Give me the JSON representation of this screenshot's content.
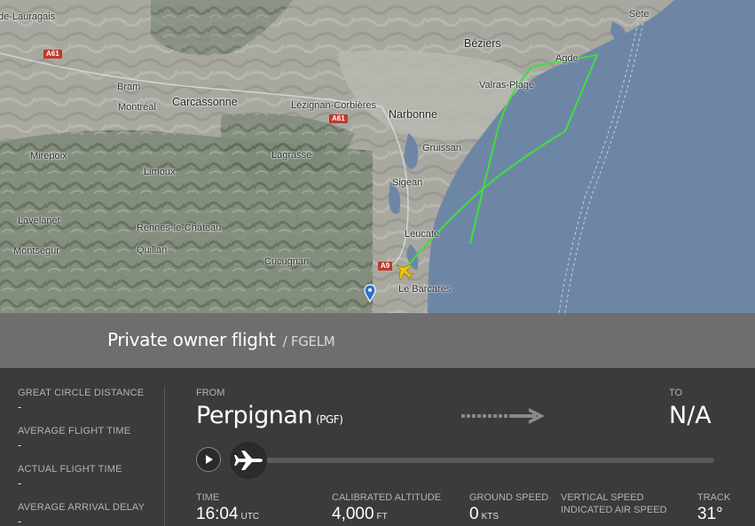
{
  "map": {
    "labels": {
      "lauragais": "de-Lauragais",
      "sete": "Sète",
      "beziers": "Béziers",
      "agde": "Agde",
      "bram": "Bram",
      "carcassonne": "Carcassonne",
      "lezignan": "Lézignan-Corbières",
      "narbonne": "Narbonne",
      "valras": "Valras-Plage",
      "montreal": "Montréal",
      "gruissan": "Gruissan",
      "mirepoix": "Mirepoix",
      "lagrasse": "Lagrasse",
      "limoux": "Limoux",
      "sigean": "Sigean",
      "lavelanet": "Lavelanet",
      "rennes": "Rennes-le-Château",
      "leucate": "Leucate",
      "montsegur": "Montségur",
      "quillan": "Quillan",
      "cucugnan": "Cucugnan",
      "barcares": "Le Barcarès"
    },
    "roads": {
      "a61_west": "A61",
      "a61_east": "A61",
      "a9": "A9"
    },
    "track_color": "#3de03d"
  },
  "flight": {
    "title": "Private owner flight",
    "callsign": "/ FGELM"
  },
  "stats": [
    {
      "label": "GREAT CIRCLE DISTANCE",
      "value": "-"
    },
    {
      "label": "AVERAGE FLIGHT TIME",
      "value": "-"
    },
    {
      "label": "ACTUAL FLIGHT TIME",
      "value": "-"
    },
    {
      "label": "AVERAGE ARRIVAL DELAY",
      "value": "-"
    }
  ],
  "route": {
    "from_label": "FROM",
    "from_city": "Perpignan",
    "from_code": "(PGF)",
    "to_label": "TO",
    "to_city": "N/A"
  },
  "metrics": {
    "time": {
      "label": "TIME",
      "value": "16:04",
      "unit": "UTC"
    },
    "altitude": {
      "label": "CALIBRATED ALTITUDE",
      "value": "4,000",
      "unit": "FT"
    },
    "ground_speed": {
      "label": "GROUND SPEED",
      "value": "0",
      "unit": "KTS"
    },
    "vertical_speed": {
      "label": "VERTICAL SPEED",
      "label2": "INDICATED AIR SPEED"
    },
    "track": {
      "label": "TRACK",
      "value": "31°"
    }
  },
  "icons": {
    "play": "play-icon",
    "plane": "airplane-icon",
    "arrow": "route-arrow-icon",
    "pin": "map-pin-icon"
  }
}
